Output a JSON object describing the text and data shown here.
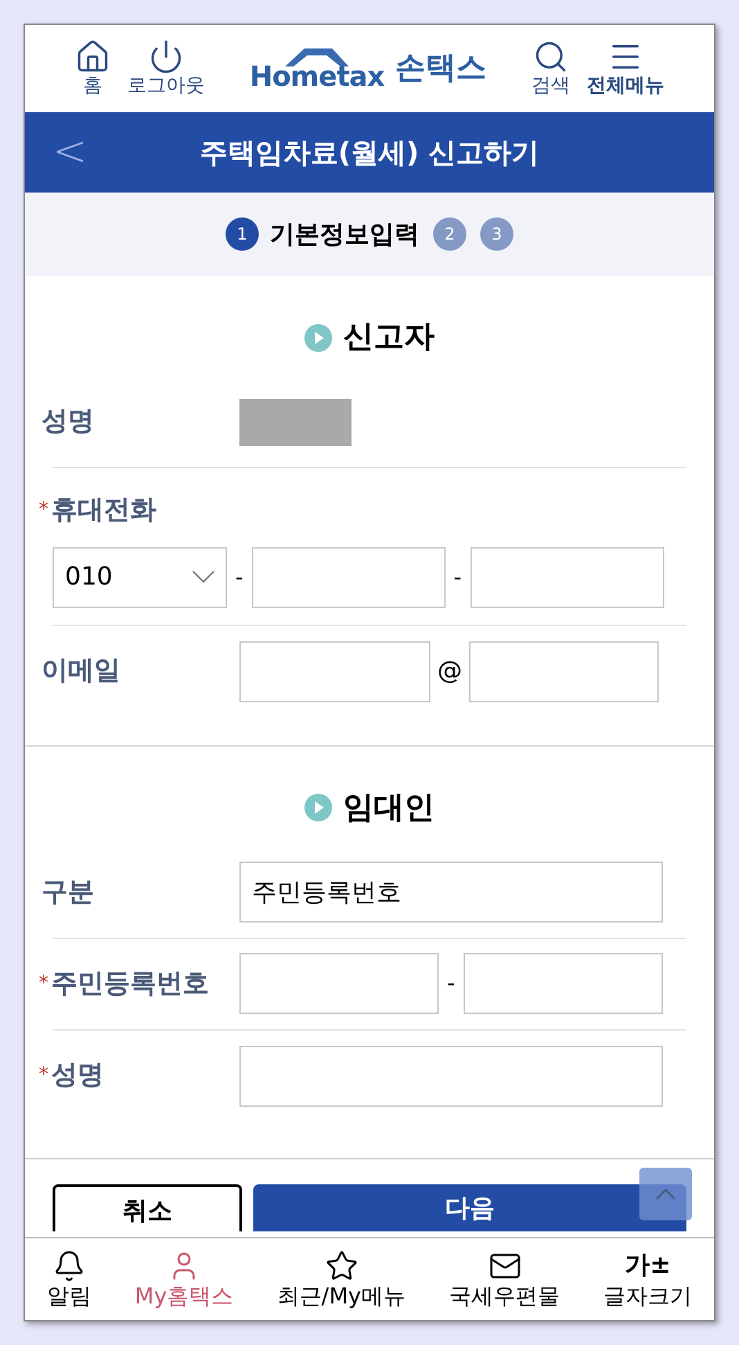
{
  "header": {
    "left": [
      {
        "kind": "home",
        "label": "홈"
      },
      {
        "kind": "logout",
        "label": "로그아웃"
      }
    ],
    "logo": {
      "brand": "Hometax",
      "suffix": "손택스"
    },
    "right": [
      {
        "kind": "search",
        "label": "검색"
      },
      {
        "kind": "menu",
        "label": "전체메뉴"
      }
    ]
  },
  "title_bar": {
    "back": "<",
    "title": "주택임차료(월세) 신고하기"
  },
  "steps": [
    {
      "number": "1",
      "label": "기본정보입력",
      "selected": true
    },
    {
      "number": "2",
      "selected": false
    },
    {
      "number": "3",
      "selected": false
    }
  ],
  "sections": [
    {
      "title": "신고자",
      "rows": [
        {
          "kind": "masked",
          "label": "성명",
          "required": false
        },
        {
          "kind": "phone",
          "label": "휴대전화",
          "required": true,
          "prefix": "010",
          "separator": "-"
        },
        {
          "kind": "email",
          "label": "이메일",
          "required": false,
          "separator": "@"
        }
      ]
    },
    {
      "title": "임대인",
      "rows": [
        {
          "kind": "value",
          "label": "구분",
          "required": false,
          "value": "주민등록번호"
        },
        {
          "kind": "split",
          "label": "주민등록번호",
          "required": true,
          "separator": "-"
        },
        {
          "kind": "single",
          "label": "성명",
          "required": true
        }
      ]
    }
  ],
  "required_mark": "*",
  "buttons": [
    {
      "label": "취소",
      "kind": "secondary"
    },
    {
      "label": "다음",
      "kind": "primary"
    }
  ],
  "bottom_nav": [
    {
      "kind": "bell",
      "label": "알림",
      "selected": false
    },
    {
      "kind": "person",
      "label": "My홈택스",
      "selected": true
    },
    {
      "kind": "star",
      "label": "최근/My메뉴",
      "selected": false
    },
    {
      "kind": "mail",
      "label": "국세우편물",
      "selected": false
    },
    {
      "kind": "font",
      "icon": "가±",
      "label": "글자크기",
      "selected": false
    }
  ]
}
